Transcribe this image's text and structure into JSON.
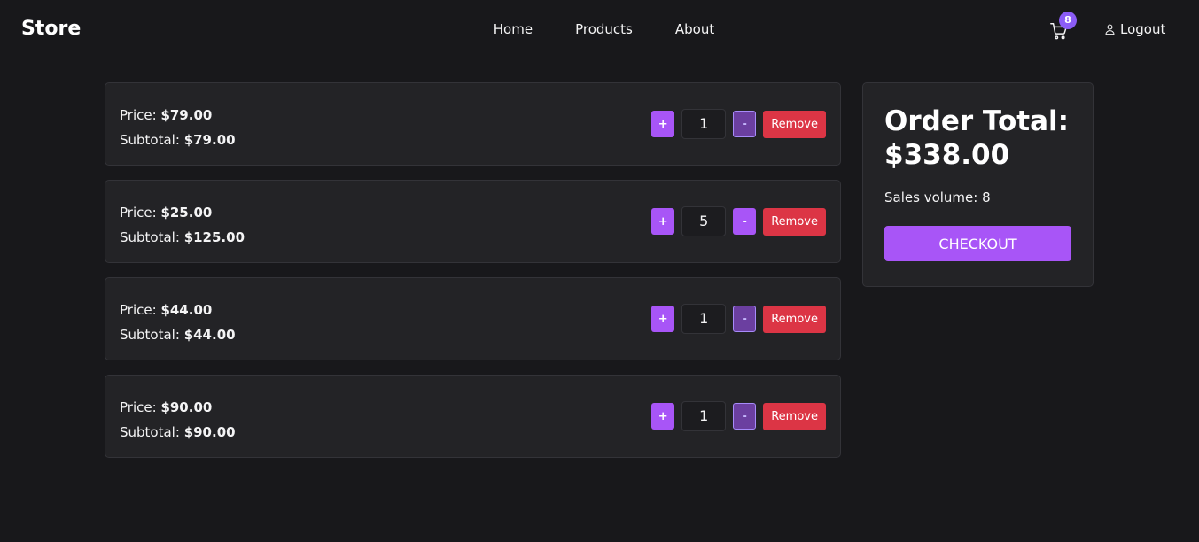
{
  "nav": {
    "brand": "Store",
    "links": [
      "Home",
      "Products",
      "About"
    ],
    "cart_count": "8",
    "logout_label": "Logout"
  },
  "cart_items": [
    {
      "price_label": "Price:",
      "price": "$79.00",
      "subtotal_label": "Subtotal:",
      "subtotal": "$79.00",
      "quantity": "1",
      "plus": "+",
      "minus": "-",
      "remove": "Remove"
    },
    {
      "price_label": "Price:",
      "price": "$25.00",
      "subtotal_label": "Subtotal:",
      "subtotal": "$125.00",
      "quantity": "5",
      "plus": "+",
      "minus": "-",
      "remove": "Remove"
    },
    {
      "price_label": "Price:",
      "price": "$44.00",
      "subtotal_label": "Subtotal:",
      "subtotal": "$44.00",
      "quantity": "1",
      "plus": "+",
      "minus": "-",
      "remove": "Remove"
    },
    {
      "price_label": "Price:",
      "price": "$90.00",
      "subtotal_label": "Subtotal:",
      "subtotal": "$90.00",
      "quantity": "1",
      "plus": "+",
      "minus": "-",
      "remove": "Remove"
    }
  ],
  "summary": {
    "title": "Order Total: $338.00",
    "sales_volume": "Sales volume: 8",
    "checkout_label": "CHECKOUT"
  },
  "colors": {
    "accent": "#a855f7",
    "danger": "#dc3545",
    "background": "#18181b",
    "card": "#232326"
  }
}
